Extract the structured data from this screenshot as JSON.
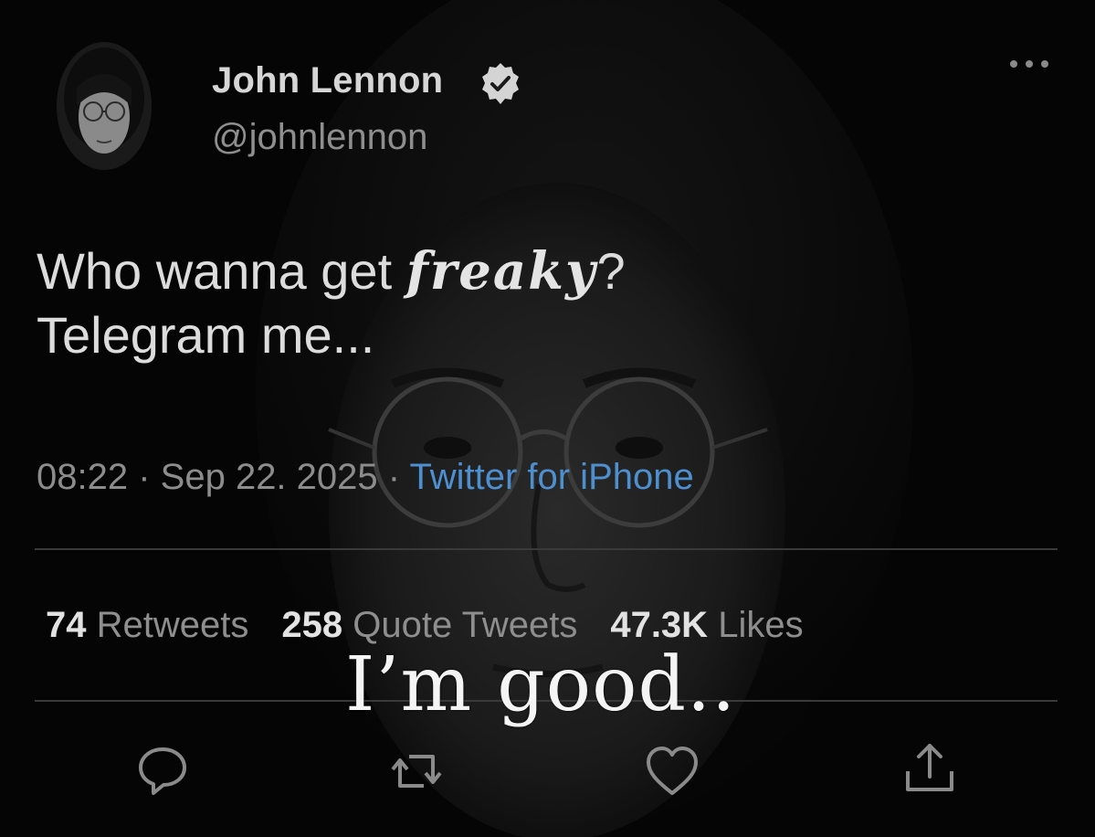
{
  "author": {
    "display_name": "John Lennon",
    "handle": "@johnlennon",
    "verified": true
  },
  "tweet": {
    "text_prefix": "Who wanna get ",
    "text_emphasis": "freaky",
    "text_suffix": "?",
    "text_line2": "Telegram me..."
  },
  "meta": {
    "time": "08:22",
    "separator": " · ",
    "date": "Sep 22. 2025",
    "source": "Twitter for iPhone"
  },
  "stats": {
    "retweets_count": "74",
    "retweets_label": "Retweets",
    "quotes_count": "258",
    "quotes_label": "Quote Tweets",
    "likes_count": "47.3K",
    "likes_label": "Likes"
  },
  "overlay_caption": "I’m good..",
  "actions": [
    "reply-icon",
    "retweet-icon",
    "like-icon",
    "share-icon"
  ],
  "colors": {
    "background": "#000000",
    "link": "#4d8fcf",
    "primary_text": "#dcdcdc",
    "secondary_text": "#8e8e8e"
  }
}
